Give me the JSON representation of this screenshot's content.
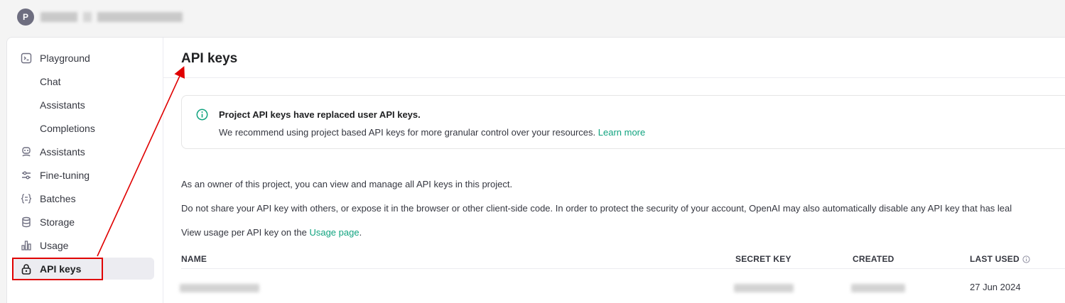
{
  "topbar": {
    "avatar_letter": "P"
  },
  "sidebar": {
    "items": [
      {
        "label": "Playground",
        "icon": "terminal-icon"
      },
      {
        "label": "Chat"
      },
      {
        "label": "Assistants"
      },
      {
        "label": "Completions"
      },
      {
        "label": "Assistants",
        "icon": "robot-icon"
      },
      {
        "label": "Fine-tuning",
        "icon": "sliders-icon"
      },
      {
        "label": "Batches",
        "icon": "braces-icon"
      },
      {
        "label": "Storage",
        "icon": "database-icon"
      },
      {
        "label": "Usage",
        "icon": "bar-chart-icon"
      },
      {
        "label": "API keys",
        "icon": "lock-icon",
        "active": true
      }
    ]
  },
  "main": {
    "title": "API keys",
    "notice": {
      "title": "Project API keys have replaced user API keys.",
      "body": "We recommend using project based API keys for more granular control over your resources.",
      "link": "Learn more"
    },
    "para1": "As an owner of this project, you can view and manage all API keys in this project.",
    "para2": "Do not share your API key with others, or expose it in the browser or other client-side code. In order to protect the security of your account, OpenAI may also automatically disable any API key that has leal",
    "para3_prefix": "View usage per API key on the",
    "para3_link": "Usage page",
    "para3_suffix": ".",
    "table": {
      "headers": {
        "name": "NAME",
        "secret_key": "SECRET KEY",
        "created": "CREATED",
        "last_used": "LAST USED"
      },
      "rows": [
        {
          "last_used": "27 Jun 2024"
        }
      ]
    }
  },
  "colors": {
    "accent": "#10a37f",
    "annotation": "#e00000"
  }
}
